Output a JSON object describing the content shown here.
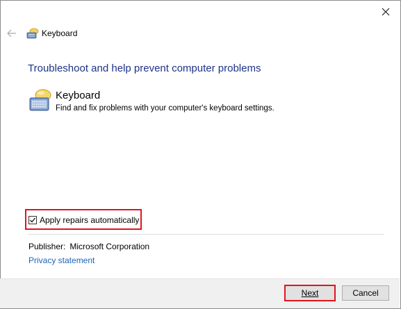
{
  "window": {
    "title": "Keyboard",
    "close_icon": "close-icon",
    "back_icon": "back-arrow-icon"
  },
  "main": {
    "heading": "Troubleshoot and help prevent computer problems",
    "item": {
      "icon": "keyboard-icon",
      "title": "Keyboard",
      "description": "Find and fix problems with your computer's keyboard settings."
    },
    "apply_repairs": {
      "label": "Apply repairs automatically",
      "checked": true
    },
    "publisher": {
      "label": "Publisher:",
      "name": "Microsoft Corporation"
    },
    "privacy_link": "Privacy statement"
  },
  "footer": {
    "next_label": "Next",
    "cancel_label": "Cancel"
  },
  "colors": {
    "heading": "#1e3287",
    "link": "#1b62b8",
    "highlight": "#e0141c",
    "footer_bg": "#f0f0f0"
  }
}
